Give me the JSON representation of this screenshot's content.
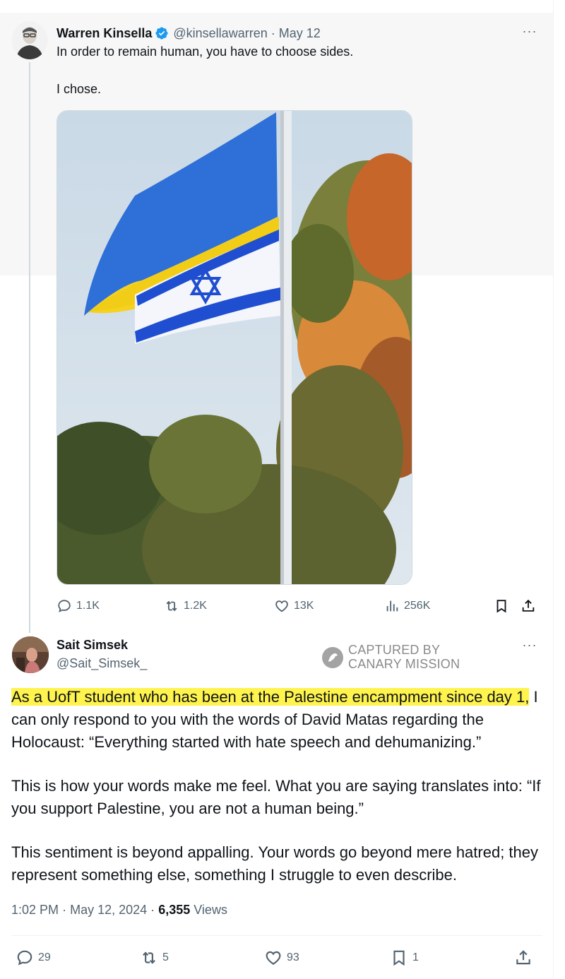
{
  "parent_tweet": {
    "author_name": "Warren Kinsella",
    "handle": "@kinsellawarren",
    "separator": "·",
    "date": "May 12",
    "more": "···",
    "text_line_1": "In order to remain human, you have to choose sides.",
    "text_line_2": "I chose.",
    "stats": {
      "replies": "1.1K",
      "reposts": "1.2K",
      "likes": "13K",
      "views": "256K"
    }
  },
  "reply_tweet": {
    "author_name": "Sait Simsek",
    "handle": "@Sait_Simsek_",
    "more": "···",
    "body": {
      "p1_highlight": "As a UofT student who has been at the Palestine encampment since day 1,",
      "p1_rest": " I can only respond to you with the words of David Matas regarding the Holocaust: “Everything started with hate speech and dehumanizing.”",
      "p2": "This is how your words make me feel. What you are saying translates into: “If you support Palestine, you are not a human being.”",
      "p3": "This sentiment is beyond appalling. Your words go beyond mere hatred; they represent something else, something I struggle to even describe."
    },
    "meta": {
      "time": "1:02 PM",
      "date": "May 12, 2024",
      "views_count": "6,355",
      "views_label": "Views",
      "separator": "·"
    },
    "stats": {
      "replies": "29",
      "reposts": "5",
      "likes": "93",
      "bookmarks": "1"
    }
  },
  "watermark": {
    "line_1": "CAPTURED BY",
    "line_2": "CANARY MISSION"
  },
  "colors": {
    "text_primary": "#0f1419",
    "text_secondary": "#536471",
    "verified_blue": "#1d9bf0",
    "highlight": "#fff34d"
  },
  "icons": [
    "reply-icon",
    "repost-icon",
    "like-icon",
    "views-icon",
    "bookmark-icon",
    "share-icon",
    "verified-badge-icon",
    "more-icon"
  ]
}
